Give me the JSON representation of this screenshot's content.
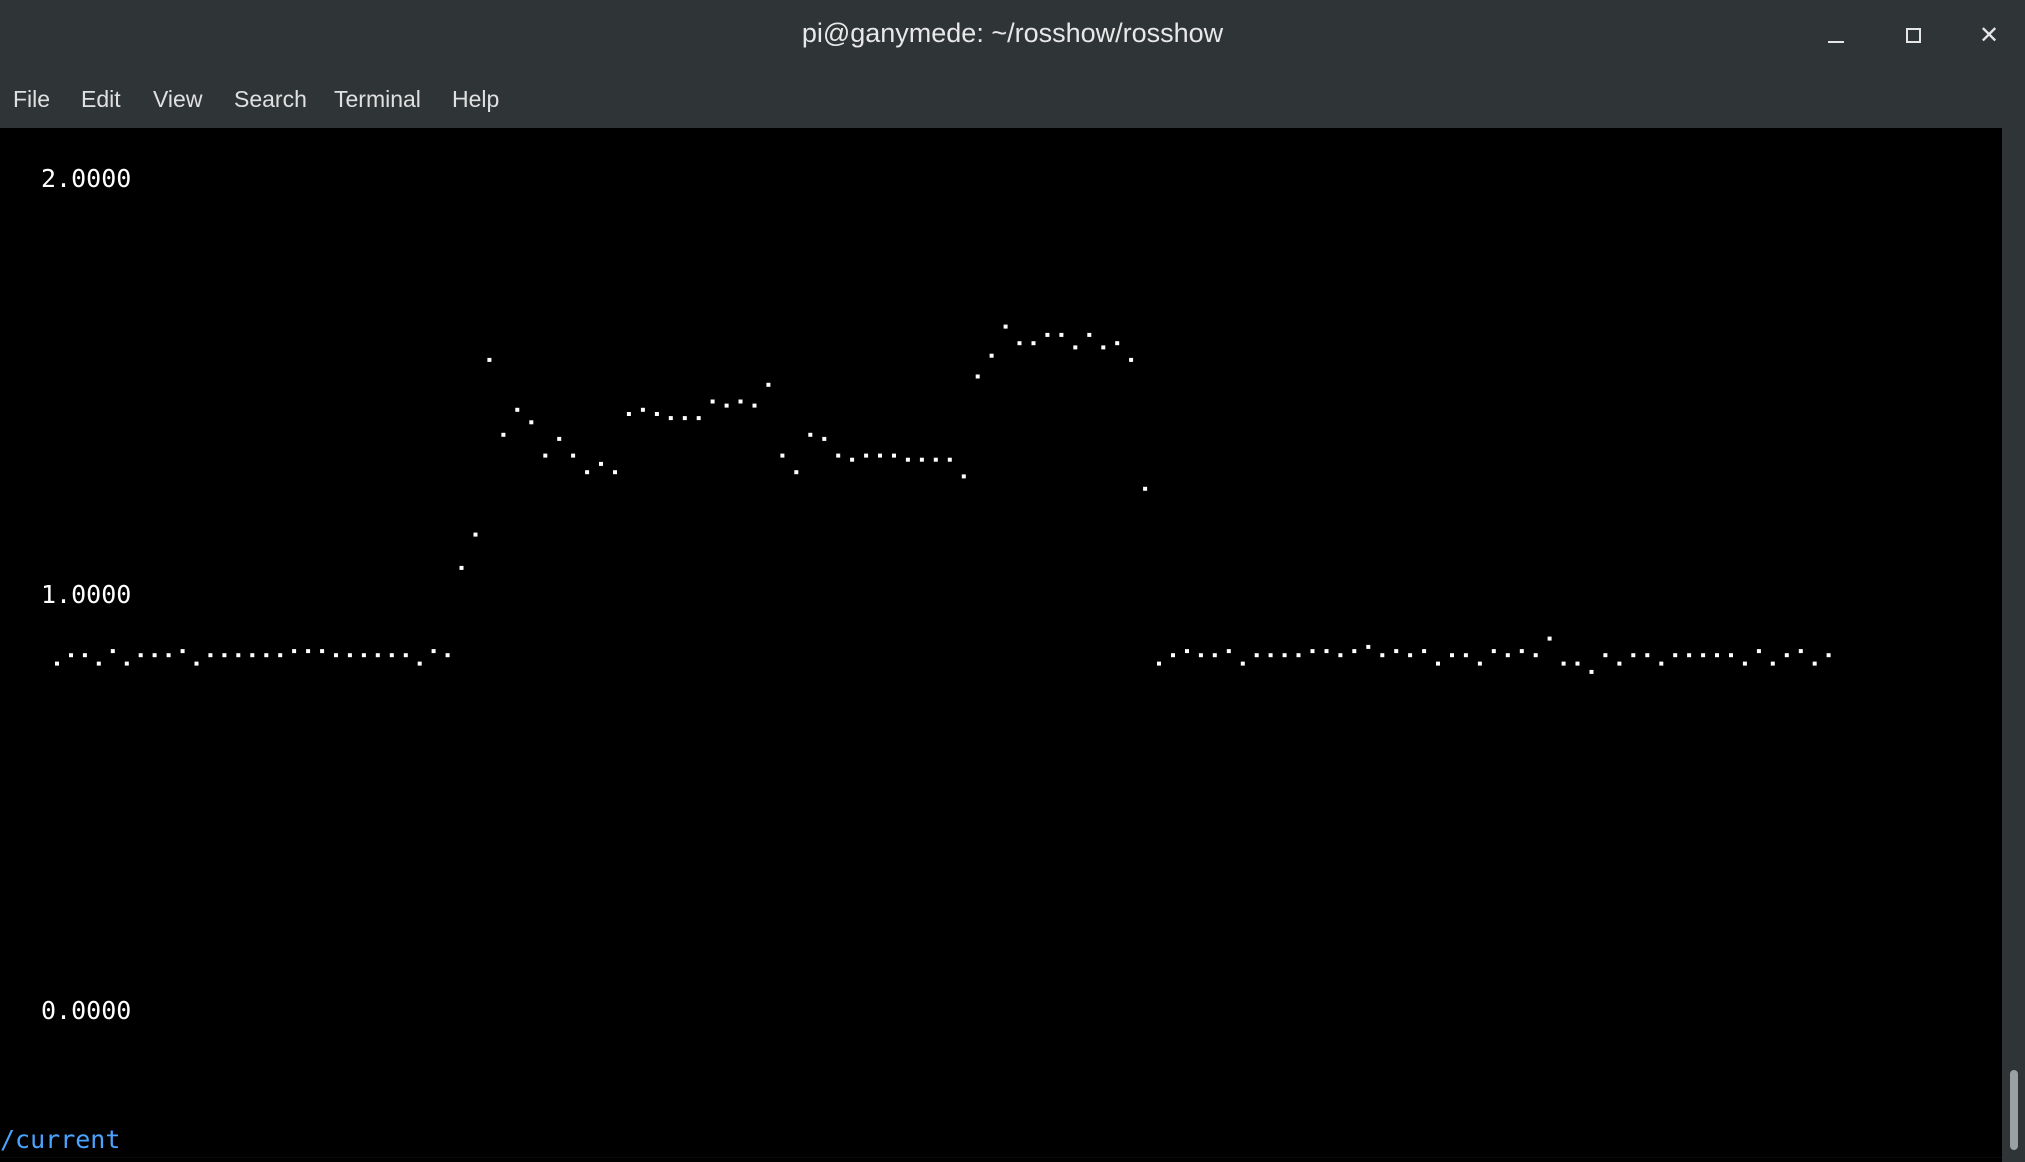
{
  "window": {
    "title": "pi@ganymede: ~/rosshow/rosshow"
  },
  "menu": {
    "items": [
      "File",
      "Edit",
      "View",
      "Search",
      "Terminal",
      "Help"
    ]
  },
  "terminal": {
    "topic": "/current",
    "colors": {
      "background": "#000000",
      "text": "#ffffff",
      "topic": "#4aa3ff",
      "chrome": "#2f3437"
    }
  },
  "chart_data": {
    "type": "scatter",
    "ylim": [
      0,
      2
    ],
    "y_tick_labels": [
      "2.0000",
      "1.0000",
      "0.0000"
    ],
    "grid": false,
    "series": [
      {
        "values": [
          0.84,
          0.86,
          0.86,
          0.84,
          0.87,
          0.84,
          0.86,
          0.86,
          0.86,
          0.87,
          0.84,
          0.86,
          0.86,
          0.86,
          0.86,
          0.86,
          0.86,
          0.87,
          0.87,
          0.87,
          0.86,
          0.86,
          0.86,
          0.86,
          0.86,
          0.86,
          0.84,
          0.87,
          0.86,
          1.07,
          1.15,
          1.57,
          1.39,
          1.45,
          1.42,
          1.34,
          1.38,
          1.34,
          1.3,
          1.32,
          1.3,
          1.44,
          1.45,
          1.44,
          1.43,
          1.43,
          1.43,
          1.47,
          1.46,
          1.47,
          1.46,
          1.51,
          1.34,
          1.3,
          1.39,
          1.38,
          1.34,
          1.33,
          1.34,
          1.34,
          1.34,
          1.33,
          1.33,
          1.33,
          1.33,
          1.29,
          1.53,
          1.58,
          1.65,
          1.61,
          1.61,
          1.63,
          1.63,
          1.6,
          1.63,
          1.6,
          1.61,
          1.57,
          1.26,
          0.84,
          0.86,
          0.87,
          0.86,
          0.86,
          0.87,
          0.84,
          0.86,
          0.86,
          0.86,
          0.86,
          0.87,
          0.87,
          0.86,
          0.87,
          0.88,
          0.86,
          0.87,
          0.86,
          0.87,
          0.84,
          0.86,
          0.86,
          0.84,
          0.87,
          0.86,
          0.87,
          0.86,
          0.9,
          0.84,
          0.84,
          0.82,
          0.86,
          0.84,
          0.86,
          0.86,
          0.84,
          0.86,
          0.86,
          0.86,
          0.86,
          0.86,
          0.84,
          0.87,
          0.84,
          0.86,
          0.87,
          0.84,
          0.86
        ]
      }
    ]
  }
}
